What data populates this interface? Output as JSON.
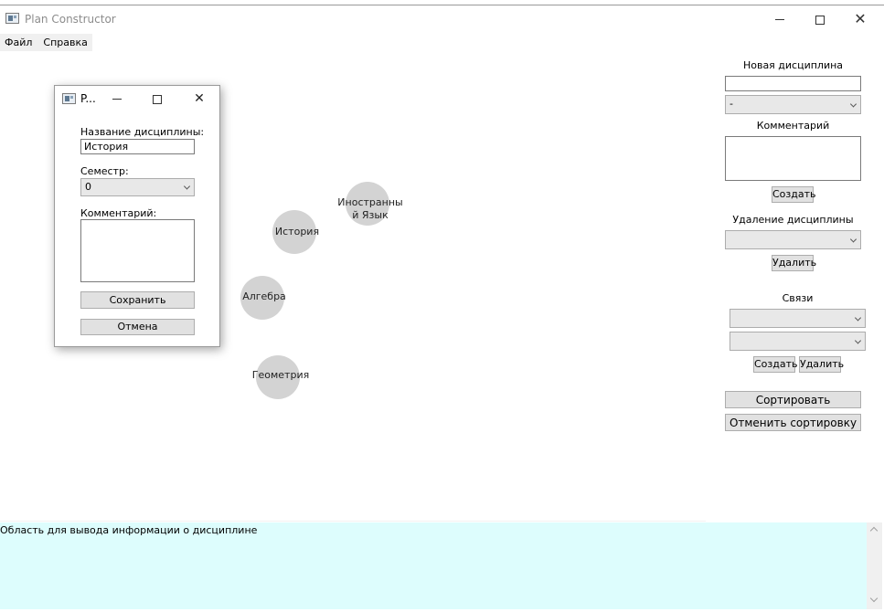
{
  "window": {
    "title": "Plan Constructor",
    "minimize_glyph": "",
    "close_glyph": "✕"
  },
  "menu": {
    "items": [
      {
        "label": "Файл"
      },
      {
        "label": "Справка"
      }
    ]
  },
  "right_panel": {
    "new_heading": "Новая дисциплина",
    "new_name_value": "",
    "semester_value": "-",
    "comment_heading": "Комментарий",
    "comment_value": "",
    "create_label": "Создать",
    "delete_heading": "Удаление дисциплины",
    "delete_select_value": "",
    "delete_label": "Удалить",
    "links_heading": "Связи",
    "link_from_value": "",
    "link_to_value": "",
    "link_create_label": "Создать",
    "link_delete_label": "Удалить",
    "sort_label": "Сортировать",
    "unsort_label": "Отменить сортировку"
  },
  "graph": {
    "nodes": [
      {
        "label": "Иностранный Язык",
        "line1": "Иностранны",
        "line2": "й Язык"
      },
      {
        "label": "История"
      },
      {
        "label": "Алгебра"
      },
      {
        "label": "Геометрия"
      }
    ],
    "node_color": "#d3d3d3"
  },
  "dialog": {
    "title": "P...",
    "close_glyph": "✕",
    "name_label": "Название дисциплины:",
    "name_value": "История",
    "semester_label": "Семестр:",
    "semester_value": "0",
    "comment_label": "Комментарий:",
    "comment_value": "",
    "save_label": "Сохранить",
    "cancel_label": "Отмена"
  },
  "info_area": {
    "text": "Область для вывода информации о дисциплине",
    "background": "#ddfdfd"
  }
}
